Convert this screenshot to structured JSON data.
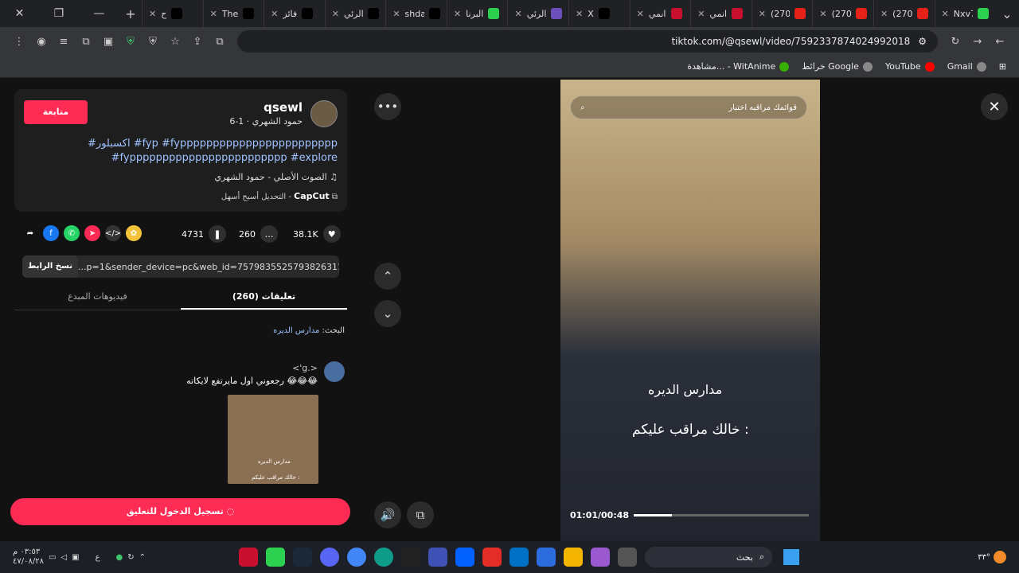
{
  "browser": {
    "tabs": [
      {
        "label": "Nxv7",
        "color": "#2bd14f"
      },
      {
        "label": "(270",
        "color": "#e62117"
      },
      {
        "label": "(270",
        "color": "#e62117"
      },
      {
        "label": "(270",
        "color": "#e62117"
      },
      {
        "label": "انمي",
        "color": "#c8102e"
      },
      {
        "label": "انمي",
        "color": "#c8102e"
      },
      {
        "label": "X",
        "color": "#000000"
      },
      {
        "label": "الرئي",
        "color": "#6b4fbb"
      },
      {
        "label": "البرنا",
        "color": "#2bd14f"
      },
      {
        "label": "shda",
        "color": "#000000"
      },
      {
        "label": "الرئي",
        "color": "#000000"
      },
      {
        "label": "فائز",
        "color": "#000000"
      },
      {
        "label": "The",
        "color": "#000000"
      },
      {
        "label": "ح",
        "color": "#000000"
      }
    ],
    "url": "tiktok.com/@qsewl/video/7592337874024992018",
    "bookmarks": [
      {
        "label": "Gmail",
        "color": "#ea4335"
      },
      {
        "label": "YouTube",
        "color": "#ff0000"
      },
      {
        "label": "خرائط Google",
        "color": "#34a853"
      },
      {
        "label": "مشاهدة... - WitAnime",
        "color": "#38b000"
      }
    ]
  },
  "post": {
    "follow_label": "متابعة",
    "username": "qsewl",
    "subtitle": "حمود الشهري · 1-6",
    "hashtags": "#اكسبلور #fyp #fypppppppppppppppppppppppp #fypppppppppppppppppppppppp #explore",
    "music": "الصوت الأصلي - حمود الشهري ♫",
    "capcut_text": "التحديل أسبح أسهل -",
    "capcut_brand": "CapCut",
    "likes": "38.1K",
    "comments": "260",
    "saves": "4731",
    "copy_label": "نسخ الرابط",
    "link": "...p=1&sender_device=pc&web_id=7579835525793826311",
    "tab_comments": "تعليقات (260)",
    "tab_creator": "فيديوهات المبدع",
    "search_prefix": "البحث:",
    "search_query": "مدارس الديره",
    "comment_user": "<'g.>",
    "comment_text": "رجعوني اول مايرتفع لايكاته 😂😂😂",
    "thumb_caption1": "مدارس الديره",
    "thumb_caption2": "خالك مراقب عليكم :",
    "login_label": "تسجيل الدخول للتعليق"
  },
  "video": {
    "search_placeholder": "قوائمك مراقبه اختبار",
    "caption1": "مدارس الديره",
    "caption2": "خالك مراقب عليكم :",
    "time": "01:01/00:48",
    "progress": 0.22
  },
  "taskbar": {
    "time": "٠٣:٥٣ م",
    "date": "٤٧/٠٨/٢٨",
    "search_label": "بحث",
    "lang": "ع",
    "weather": "٣٣°"
  }
}
